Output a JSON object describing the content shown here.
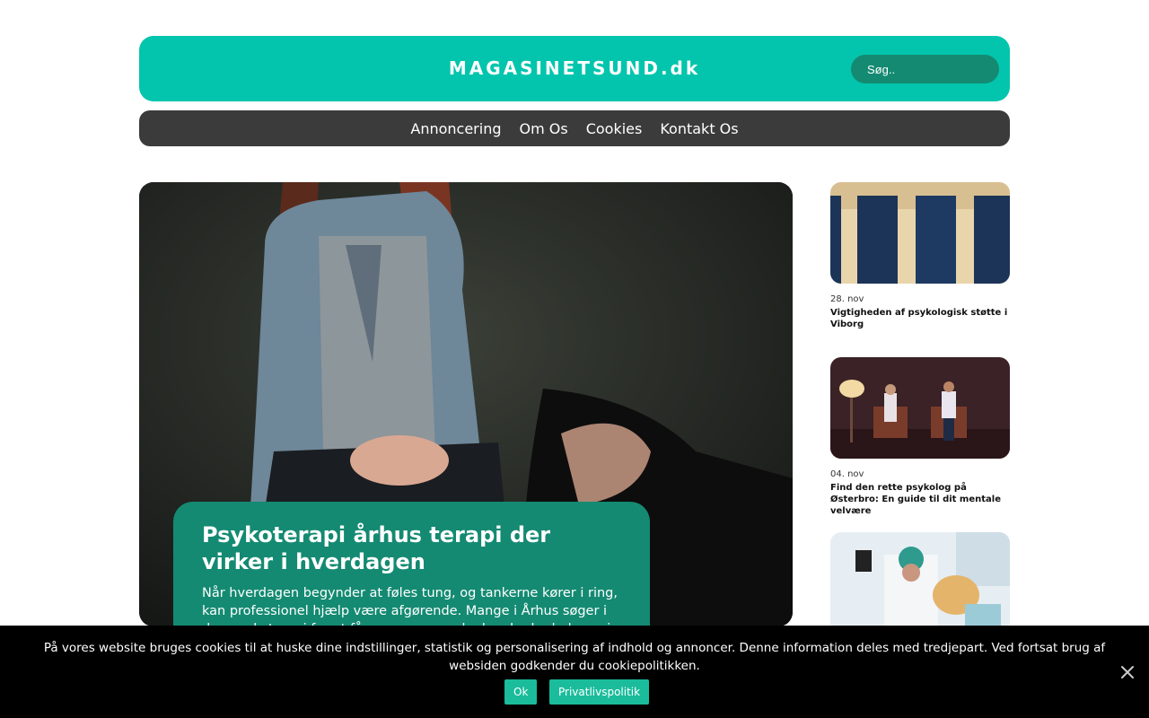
{
  "header": {
    "logo": "MAGASINETSUND.dk",
    "search_placeholder": "Søg.."
  },
  "nav": {
    "items": [
      "Annoncering",
      "Om Os",
      "Cookies",
      "Kontakt Os"
    ]
  },
  "hero": {
    "title": "Psykoterapi århus terapi der virker i hverdagen",
    "excerpt": "Når hverdagen begynder at føles tung, og tankerne kører i ring, kan professionel hjælp være afgørende. Mange i Århus søger i dag psykoterapi for at få mere ro, overskud og bedre balance i livet."
  },
  "sidebar": {
    "articles": [
      {
        "date": "28. nov",
        "title": "Vigtigheden af psykologisk støtte i Viborg"
      },
      {
        "date": "04. nov",
        "title": "Find den rette psykolog på Østerbro: En guide til dit mentale velvære"
      },
      {
        "date": "",
        "title": ""
      }
    ]
  },
  "cookie": {
    "text": "På vores website bruges cookies til at huske dine indstillinger, statistik og personalisering af indhold og annoncer. Denne information deles med tredjepart. Ved fortsat brug af websiden godkender du cookiepolitikken.",
    "ok_label": "Ok",
    "privacy_label": "Privatlivspolitik"
  }
}
